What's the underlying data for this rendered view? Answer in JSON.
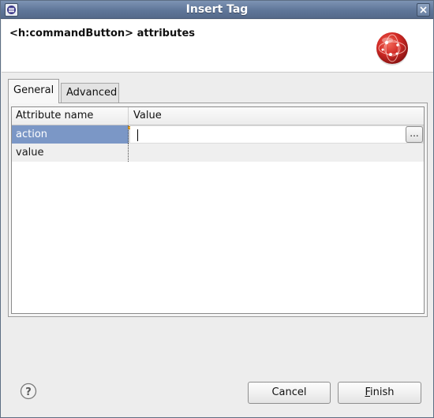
{
  "window": {
    "title": "Insert Tag"
  },
  "header": {
    "heading": "<h:commandButton> attributes",
    "logo_icon": "jboss-red-ball-icon"
  },
  "tabs": [
    {
      "label": "General",
      "active": true
    },
    {
      "label": "Advanced",
      "active": false
    }
  ],
  "table": {
    "columns": [
      "Attribute name",
      "Value"
    ],
    "rows": [
      {
        "name": "action",
        "value": "",
        "selected": true
      },
      {
        "name": "value",
        "value": "",
        "selected": false
      }
    ],
    "browse_label": "..."
  },
  "footer": {
    "help_icon": "help-icon",
    "cancel_label": "Cancel",
    "finish_label_first": "F",
    "finish_label_rest": "inish"
  },
  "colors": {
    "titlebar": "#5f7699",
    "selection": "#7b97c6",
    "logo": "#d22b26"
  }
}
